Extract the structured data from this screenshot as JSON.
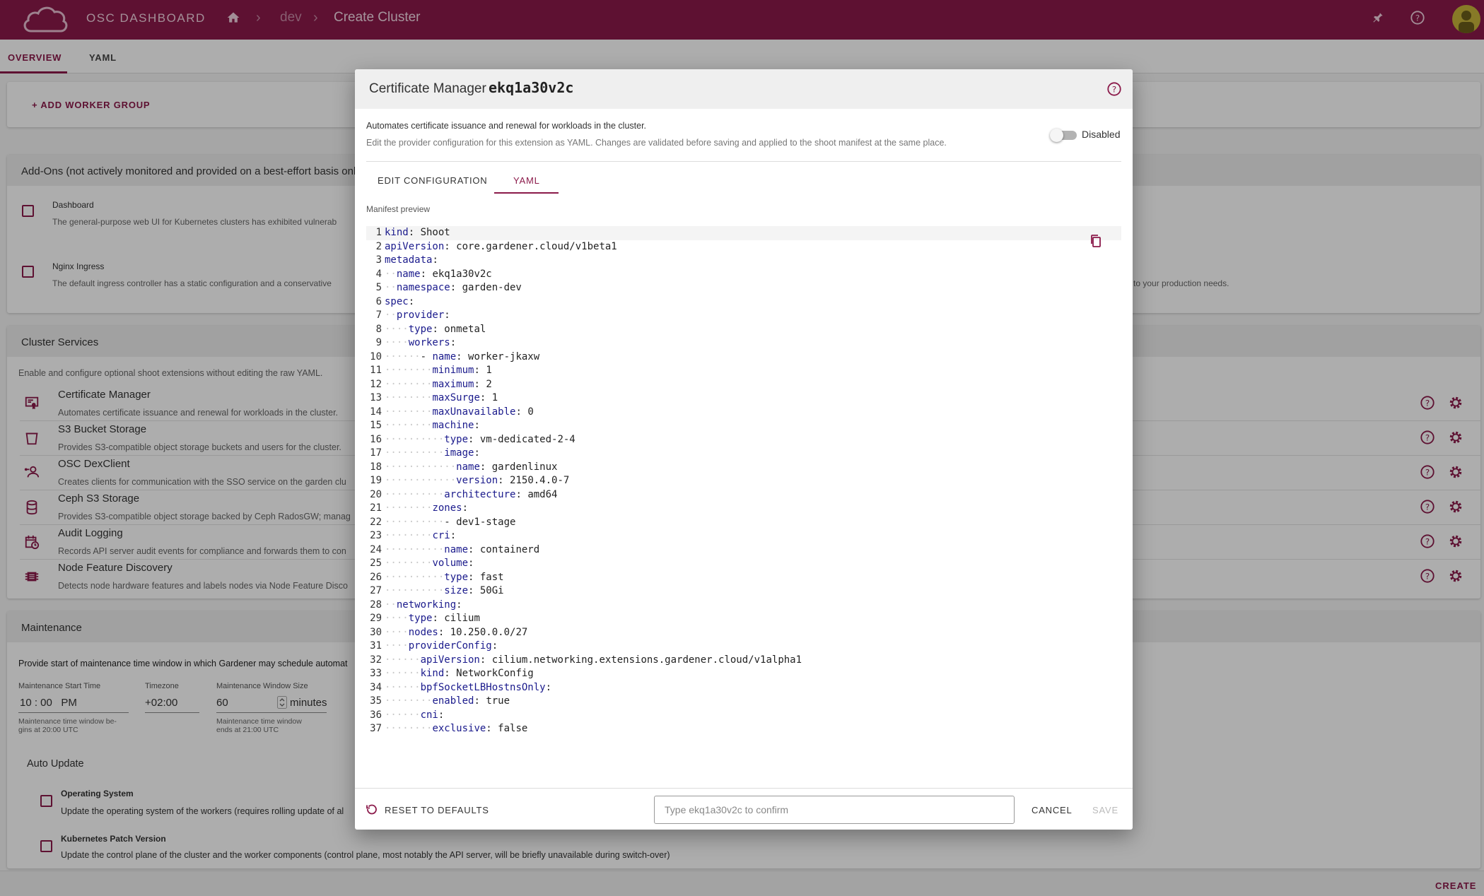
{
  "header": {
    "app_title": "OSC DASHBOARD",
    "breadcrumb": {
      "project": "dev",
      "current": "Create Cluster"
    }
  },
  "tabs": {
    "overview": "OVERVIEW",
    "yaml": "YAML"
  },
  "workers": {
    "add_label": "ADD WORKER GROUP"
  },
  "addons": {
    "title": "Add-Ons (not actively monitored and provided on a best-effort basis only)",
    "items": [
      {
        "title": "Dashboard",
        "desc": "The general-purpose web UI for Kubernetes clusters has exhibited vulnerab"
      },
      {
        "title": "Nginx Ingress",
        "desc": "The default ingress controller has a static configuration and a conservative"
      }
    ],
    "trailing_text": "to your production needs."
  },
  "services": {
    "title": "Cluster Services",
    "intro": "Enable and configure optional shoot extensions without editing the raw YAML.",
    "items": [
      {
        "title": "Certificate Manager",
        "desc": "Automates certificate issuance and renewal for workloads in the cluster."
      },
      {
        "title": "S3 Bucket Storage",
        "desc": "Provides S3-compatible object storage buckets and users for the cluster."
      },
      {
        "title": "OSC DexClient",
        "desc": "Creates clients for communication with the SSO service on the garden clu"
      },
      {
        "title": "Ceph S3 Storage",
        "desc": "Provides S3-compatible object storage backed by Ceph RadosGW; manag"
      },
      {
        "title": "Audit Logging",
        "desc": "Records API server audit events for compliance and forwards them to con"
      },
      {
        "title": "Node Feature Discovery",
        "desc": "Detects node hardware features and labels nodes via Node Feature Disco"
      }
    ]
  },
  "maintenance": {
    "title": "Maintenance",
    "intro": "Provide start of maintenance time window in which Gardener may schedule automat",
    "start_label": "Maintenance Start Time",
    "start_value": "10 : 00   PM",
    "start_hint_1": "Maintenance time window be-",
    "start_hint_2": "gins at 20:00 UTC",
    "tz_label": "Timezone",
    "tz_value": "+02:00",
    "size_label": "Maintenance Window Size",
    "size_value": "60",
    "size_unit": "minutes",
    "size_hint_1": "Maintenance time window",
    "size_hint_2": "ends at 21:00 UTC",
    "auto_update_title": "Auto Update",
    "os_title": "Operating System",
    "os_desc": "Update the operating system of the workers (requires rolling update of al",
    "k8s_title": "Kubernetes Patch Version",
    "k8s_desc": "Update the control plane of the cluster and the worker components (control plane, most notably the API server, will be briefly unavailable during switch-over)"
  },
  "footer": {
    "create_label": "CREATE"
  },
  "dialog": {
    "title": "Certificate Manager",
    "cluster_id": "ekq1a30v2c",
    "desc_1": "Automates certificate issuance and renewal for workloads in the cluster.",
    "desc_2": "Edit the provider configuration for this extension as YAML. Changes are validated before saving and applied to the shoot manifest at the same place.",
    "toggle_label": "Disabled",
    "tabs": {
      "edit": "EDIT CONFIGURATION",
      "yaml": "YAML"
    },
    "manifest_label": "Manifest preview",
    "reset_label": "RESET TO DEFAULTS",
    "confirm_placeholder": "Type ekq1a30v2c to confirm",
    "cancel_label": "CANCEL",
    "save_label": "SAVE",
    "yaml_lines": [
      {
        "n": "1",
        "indent": 0,
        "key": "kind",
        "value": "Shoot"
      },
      {
        "n": "2",
        "indent": 0,
        "key": "apiVersion",
        "value": "core.gardener.cloud/v1beta1"
      },
      {
        "n": "3",
        "indent": 0,
        "key": "metadata",
        "value": ""
      },
      {
        "n": "4",
        "indent": 2,
        "key": "name",
        "value": "ekq1a30v2c"
      },
      {
        "n": "5",
        "indent": 2,
        "key": "namespace",
        "value": "garden-dev"
      },
      {
        "n": "6",
        "indent": 0,
        "key": "spec",
        "value": ""
      },
      {
        "n": "7",
        "indent": 2,
        "key": "provider",
        "value": ""
      },
      {
        "n": "8",
        "indent": 4,
        "key": "type",
        "value": "onmetal"
      },
      {
        "n": "9",
        "indent": 4,
        "key": "workers",
        "value": ""
      },
      {
        "n": "10",
        "indent": 6,
        "dash": true,
        "key": "name",
        "value": "worker-jkaxw"
      },
      {
        "n": "11",
        "indent": 8,
        "key": "minimum",
        "value": "1"
      },
      {
        "n": "12",
        "indent": 8,
        "key": "maximum",
        "value": "2"
      },
      {
        "n": "13",
        "indent": 8,
        "key": "maxSurge",
        "value": "1"
      },
      {
        "n": "14",
        "indent": 8,
        "key": "maxUnavailable",
        "value": "0"
      },
      {
        "n": "15",
        "indent": 8,
        "key": "machine",
        "value": ""
      },
      {
        "n": "16",
        "indent": 10,
        "key": "type",
        "value": "vm-dedicated-2-4"
      },
      {
        "n": "17",
        "indent": 10,
        "key": "image",
        "value": ""
      },
      {
        "n": "18",
        "indent": 12,
        "key": "name",
        "value": "gardenlinux"
      },
      {
        "n": "19",
        "indent": 12,
        "key": "version",
        "value": "2150.4.0-7"
      },
      {
        "n": "20",
        "indent": 10,
        "key": "architecture",
        "value": "amd64"
      },
      {
        "n": "21",
        "indent": 8,
        "key": "zones",
        "value": ""
      },
      {
        "n": "22",
        "indent": 10,
        "dash": true,
        "key": "",
        "value": "dev1-stage"
      },
      {
        "n": "23",
        "indent": 8,
        "key": "cri",
        "value": ""
      },
      {
        "n": "24",
        "indent": 10,
        "key": "name",
        "value": "containerd"
      },
      {
        "n": "25",
        "indent": 8,
        "key": "volume",
        "value": ""
      },
      {
        "n": "26",
        "indent": 10,
        "key": "type",
        "value": "fast"
      },
      {
        "n": "27",
        "indent": 10,
        "key": "size",
        "value": "50Gi"
      },
      {
        "n": "28",
        "indent": 2,
        "key": "networking",
        "value": ""
      },
      {
        "n": "29",
        "indent": 4,
        "key": "type",
        "value": "cilium"
      },
      {
        "n": "30",
        "indent": 4,
        "key": "nodes",
        "value": "10.250.0.0/27"
      },
      {
        "n": "31",
        "indent": 4,
        "key": "providerConfig",
        "value": ""
      },
      {
        "n": "32",
        "indent": 6,
        "key": "apiVersion",
        "value": "cilium.networking.extensions.gardener.cloud/v1alpha1"
      },
      {
        "n": "33",
        "indent": 6,
        "key": "kind",
        "value": "NetworkConfig"
      },
      {
        "n": "34",
        "indent": 6,
        "key": "bpfSocketLBHostnsOnly",
        "value": ""
      },
      {
        "n": "35",
        "indent": 8,
        "key": "enabled",
        "value": "true"
      },
      {
        "n": "36",
        "indent": 6,
        "key": "cni",
        "value": ""
      },
      {
        "n": "37",
        "indent": 8,
        "key": "exclusive",
        "value": "false"
      }
    ]
  },
  "colors": {
    "brand": "#8b1a4a",
    "yaml_key": "#1a1a8c"
  }
}
